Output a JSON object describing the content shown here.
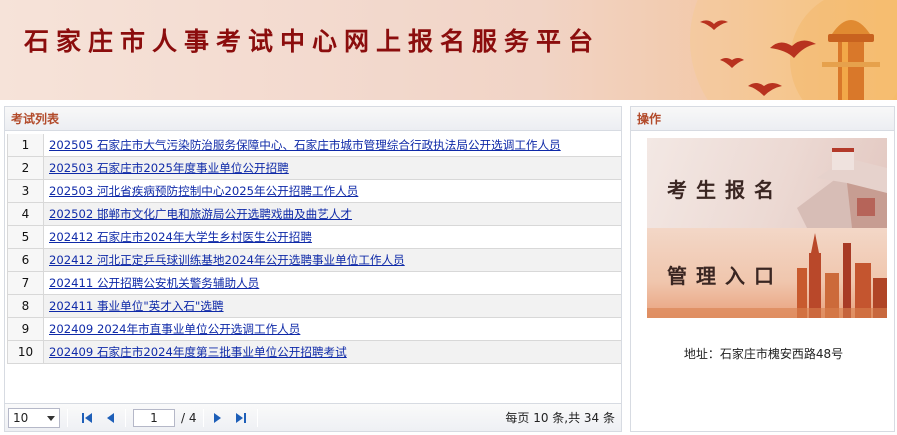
{
  "banner": {
    "title": "石家庄市人事考试中心网上报名服务平台"
  },
  "exam_list": {
    "title": "考试列表",
    "rows": [
      {
        "no": "1",
        "text": "202505 石家庄市大气污染防治服务保障中心、石家庄市城市管理综合行政执法局公开选调工作人员"
      },
      {
        "no": "2",
        "text": "202503 石家庄市2025年度事业单位公开招聘"
      },
      {
        "no": "3",
        "text": "202503 河北省疾病预防控制中心2025年公开招聘工作人员"
      },
      {
        "no": "4",
        "text": "202502 邯郸市文化广电和旅游局公开选聘戏曲及曲艺人才"
      },
      {
        "no": "5",
        "text": "202412 石家庄市2024年大学生乡村医生公开招聘"
      },
      {
        "no": "6",
        "text": "202412 河北正定乒乓球训练基地2024年公开选聘事业单位工作人员"
      },
      {
        "no": "7",
        "text": "202411 公开招聘公安机关警务辅助人员"
      },
      {
        "no": "8",
        "text": "202411 事业单位\"英才入石\"选聘"
      },
      {
        "no": "9",
        "text": "202409 2024年市直事业单位公开选调工作人员"
      },
      {
        "no": "10",
        "text": "202409 石家庄市2024年度第三批事业单位公开招聘考试"
      }
    ]
  },
  "pager": {
    "page_size": "10",
    "current_page": "1",
    "total_pages": "/ 4",
    "summary": "每页 10 条,共 34 条"
  },
  "actions": {
    "title": "操作",
    "register_label": "考生报名",
    "manage_label": "管理入口",
    "address": "地址：石家庄市槐安西路48号"
  }
}
